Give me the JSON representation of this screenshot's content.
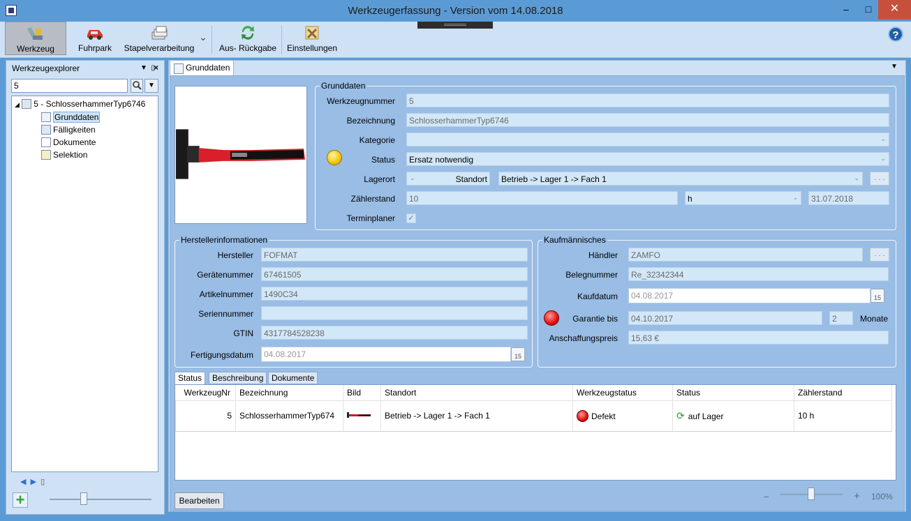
{
  "window": {
    "title": "Werkzeugerfassung - Version vom 14.08.2018",
    "minimize": "‒",
    "maximize": "□",
    "close": "✕"
  },
  "toolbar": {
    "items": [
      {
        "label": "Werkzeug",
        "icon": "tools-icon"
      },
      {
        "label": "Fuhrpark",
        "icon": "car-icon"
      },
      {
        "label": "Stapelverarbeitung",
        "icon": "batch-stack-icon"
      },
      {
        "label": "Aus- Rückgabe",
        "icon": "exchange-arrows-icon"
      },
      {
        "label": "Einstellungen",
        "icon": "settings-tools-icon"
      }
    ],
    "help": "?"
  },
  "explorer": {
    "title": "Werkzeugexplorer",
    "search_value": "5",
    "tree": {
      "root": "5 - SchlosserhammerTyp6746",
      "children": [
        "Grunddaten",
        "Fälligkeiten",
        "Dokumente",
        "Selektion"
      ]
    }
  },
  "tabs": {
    "main": "Grunddaten"
  },
  "grunddaten": {
    "group_title": "Grunddaten",
    "werkzeugnummer_label": "Werkzeugnummer",
    "werkzeugnummer": "5",
    "bezeichnung_label": "Bezeichnung",
    "bezeichnung": "SchlosserhammerTyp6746",
    "kategorie_label": "Kategorie",
    "kategorie": "",
    "status_label": "Status",
    "status": "Ersatz notwendig",
    "lagerort_label": "Lagerort",
    "standort_label": "Standort",
    "standort": "Betrieb -> Lager 1 -> Fach 1",
    "zaehlerstand_label": "Zählerstand",
    "zaehlerstand": "10",
    "einheit": "h",
    "zaehler_datum": "31.07.2018",
    "terminplaner_label": "Terminplaner",
    "terminplaner_checked": true
  },
  "hersteller": {
    "group_title": "Herstellerinformationen",
    "hersteller_label": "Hersteller",
    "hersteller": "FOFMAT",
    "geraetenummer_label": "Gerätenummer",
    "geraetenummer": "67461505",
    "artikelnummer_label": "Artikelnummer",
    "artikelnummer": "1490C34",
    "seriennummer_label": "Seriennummer",
    "seriennummer": "",
    "gtin_label": "GTIN",
    "gtin": "4317784528238",
    "fertigungsdatum_label": "Fertigungsdatum",
    "fertigungsdatum": "04.08.2017"
  },
  "kauf": {
    "group_title": "Kaufmännisches",
    "haendler_label": "Händler",
    "haendler": "ZAMFO",
    "belegnummer_label": "Belegnummer",
    "belegnummer": "Re_32342344",
    "kaufdatum_label": "Kaufdatum",
    "kaufdatum": "04.08.2017",
    "garantie_label": "Garantie bis",
    "garantie": "04.10.2017",
    "garantie_monate": "2",
    "monate_label": "Monate",
    "preis_label": "Anschaffungspreis",
    "preis": "15,63 €"
  },
  "bottom_tabs": [
    "Status",
    "Beschreibung",
    "Dokumente"
  ],
  "grid": {
    "columns": [
      "WerkzeugNr",
      "Bezeichnung",
      "Bild",
      "Standort",
      "Werkzeugstatus",
      "Status",
      "Zählerstand"
    ],
    "rows": [
      {
        "nr": "5",
        "bezeichnung": "SchlosserhammerTyp674",
        "standort": "Betrieb -> Lager 1 -> Fach 1",
        "werkzeugstatus": "Defekt",
        "status": "auf Lager",
        "zaehlerstand": "10 h"
      }
    ]
  },
  "buttons": {
    "bearbeiten": "Bearbeiten",
    "dots": ". . ."
  },
  "zoom": {
    "minus": "−",
    "plus": "+",
    "value": "100%",
    "level": 0.5
  },
  "colors": {
    "accent": "#5b9bd5",
    "panel": "#99bde5",
    "field": "#d2e7f8",
    "close": "#c7503d"
  }
}
